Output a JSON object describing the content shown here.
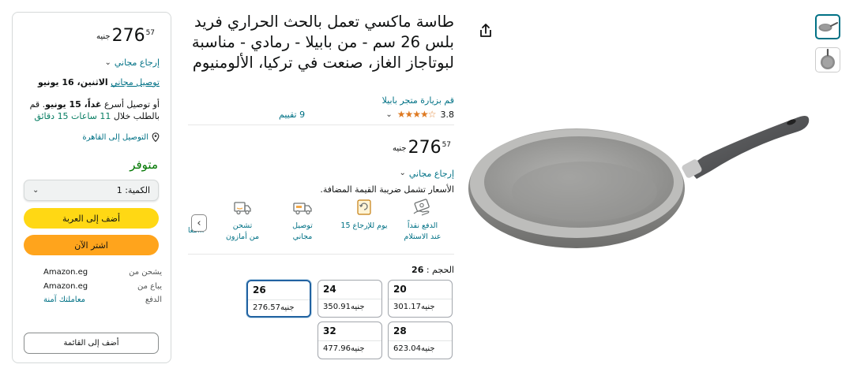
{
  "buy_box": {
    "price": {
      "currency": "جنيه",
      "main": "276",
      "fraction": "57"
    },
    "free_return": "إرجاع مجاني",
    "delivery_prefix": "توصيل مجاني",
    "delivery_date": "الاثنين، 16 يونيو",
    "fast_delivery": {
      "prefix": "أو توصيل أسرع",
      "date": "غداً، 15 يونيو",
      "condition": ". قم بالطلب خلال",
      "countdown": "11 ساعات 15 دقائق"
    },
    "location": "التوصيل إلى القاهرة",
    "stock": "متوفر",
    "quantity_label": "الكمية: 1",
    "add_to_cart": "أضف إلى العربة",
    "buy_now": "اشتر الآن",
    "info": [
      {
        "key": "يشحن من",
        "value": "Amazon.eg",
        "link": false
      },
      {
        "key": "يباع من",
        "value": "Amazon.eg",
        "link": false
      },
      {
        "key": "الدفع",
        "value": "معاملتك آمنة",
        "link": true
      }
    ],
    "add_to_list": "أضف إلى القائمة"
  },
  "product": {
    "title": "طاسة ماكسي تعمل بالحث الحراري فريد بلس 26 سم - من بابيلا - رمادي - مناسبة لبوتاجاز الغاز، صنعت في تركيا، الألومنيوم",
    "store_link": "قم بزيارة متجر بابيلا",
    "rating": "3.8",
    "rating_count": "9 تقييم",
    "price": {
      "currency": "جنيه",
      "main": "276",
      "fraction": "57"
    },
    "free_return": "إرجاع مجاني",
    "vat_note": "الأسعار تشمل ضريبة القيمة المضافة.",
    "features": [
      {
        "icon": "cash-on-delivery-icon",
        "line1": "الدفع نقداً",
        "line2": "عند الاستلام"
      },
      {
        "icon": "return-15-days-icon",
        "line1": "15 يوم للإرجاع",
        "line2": ""
      },
      {
        "icon": "free-delivery-truck-icon",
        "line1": "توصيل",
        "line2": "مجاني"
      },
      {
        "icon": "amazon-shipping-truck-icon",
        "line1": "تشحن",
        "line2": "من أمازون"
      }
    ],
    "features_cut_label": "معا...",
    "size_label": "الحجم :",
    "size_selected": "26",
    "sizes": [
      {
        "size": "20",
        "price": "301.17جنيه"
      },
      {
        "size": "24",
        "price": "350.91جنيه"
      },
      {
        "size": "26",
        "price": "276.57جنيه",
        "selected": true
      },
      {
        "size": "28",
        "price": "623.04جنيه"
      },
      {
        "size": "32",
        "price": "477.96جنيه"
      }
    ]
  },
  "gallery": {
    "thumbnails": [
      "pan-side-thumbnail",
      "pan-top-thumbnail"
    ],
    "main_image": "gray-frying-pan-image"
  },
  "colors": {
    "link": "#007185",
    "cart": "#ffd814",
    "buy": "#ffa41c",
    "star": "#de7921",
    "stock": "#007600",
    "selected_border": "#2162a1"
  }
}
